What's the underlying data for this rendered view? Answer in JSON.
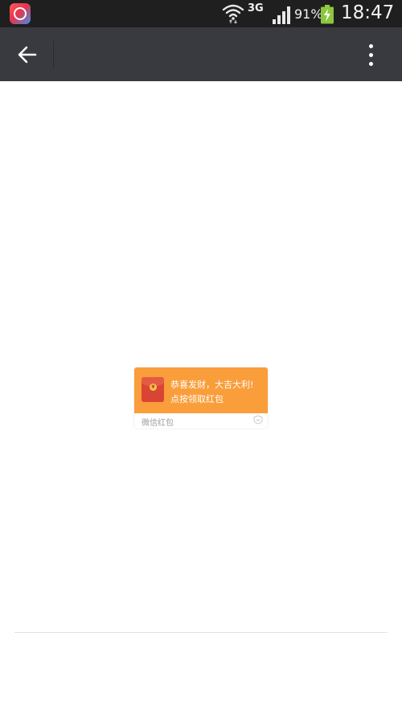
{
  "status_bar": {
    "network_type": "3G",
    "battery_percent": "91%",
    "time": "18:47",
    "icons": {
      "app_notification": "app-notification-icon",
      "wifi": "wifi-icon",
      "signal": "signal-strength-icon",
      "battery": "battery-charging-icon"
    }
  },
  "toolbar": {
    "back_icon": "back-arrow-icon",
    "menu_icon": "more-vertical-icon",
    "background_color": "#393a3f"
  },
  "red_packet": {
    "greeting": "恭喜发财，大吉大利!",
    "action": "点按领取红包",
    "footer_label": "微信红包",
    "card_color": "#fa9d3b",
    "envelope_color": "#d94434",
    "icons": {
      "envelope": "red-envelope-icon",
      "footer": "wechat-pay-icon"
    }
  }
}
